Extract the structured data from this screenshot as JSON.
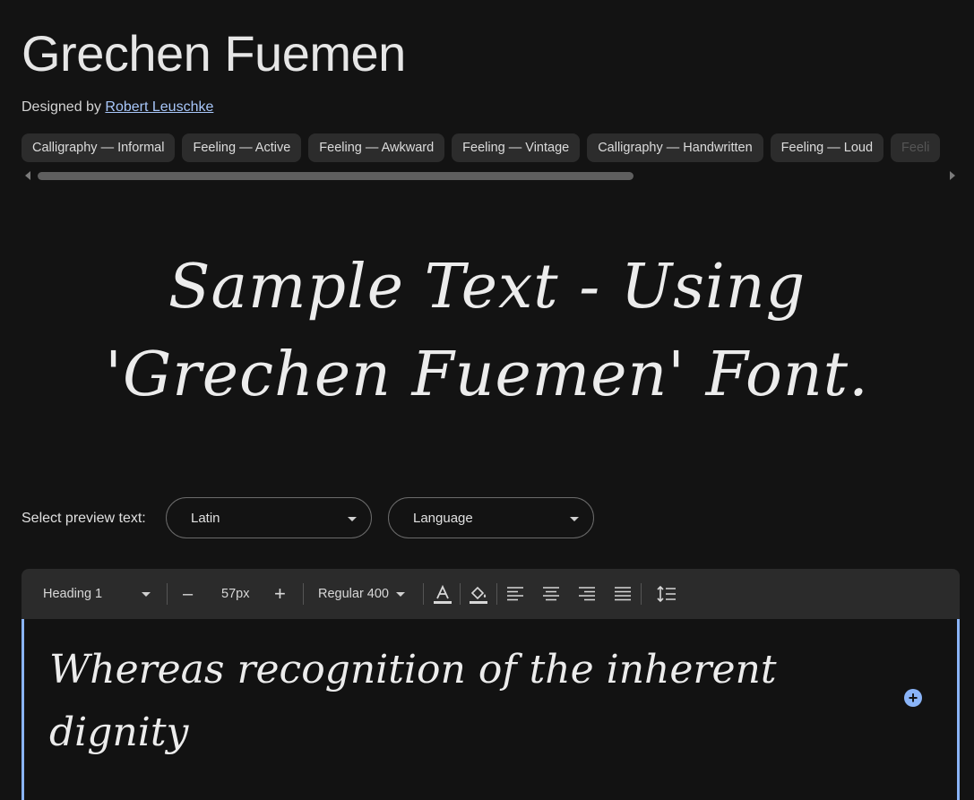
{
  "font": {
    "name": "Grechen Fuemen",
    "designed_by_label": "Designed by",
    "designer": "Robert Leuschke"
  },
  "tags": [
    "Calligraphy — Informal",
    "Feeling — Active",
    "Feeling — Awkward",
    "Feeling — Vintage",
    "Calligraphy — Handwritten",
    "Feeling — Loud",
    "Feeli"
  ],
  "preview": {
    "line1": "Sample Text - Using",
    "line2": "'Grechen Fuemen' Font."
  },
  "select_preview": {
    "label": "Select preview text:",
    "script": "Latin",
    "language": "Language"
  },
  "toolbar": {
    "style": "Heading 1",
    "size_minus": "–",
    "size": "57px",
    "size_plus": "+",
    "weight": "Regular 400"
  },
  "editor": {
    "text": "Whereas recognition of the inherent dignity"
  },
  "colors": {
    "background": "#131313",
    "accent": "#8ab4f8",
    "link": "#a8c7fa",
    "tag_bg": "#2c2c2c",
    "toolbar_bg": "#2b2b2b"
  }
}
